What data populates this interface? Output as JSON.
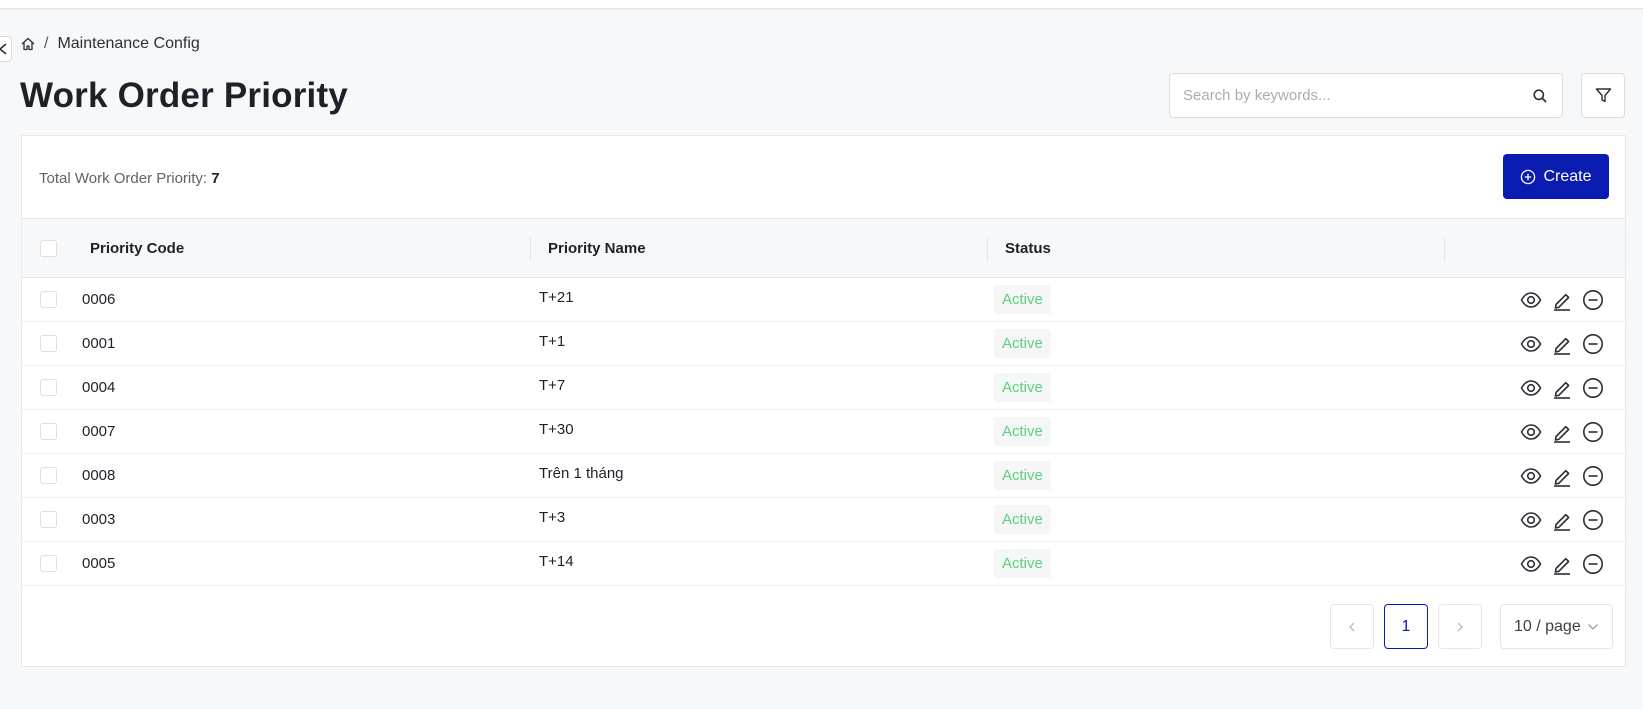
{
  "breadcrumb": {
    "items": [
      "Maintenance Config"
    ]
  },
  "page": {
    "title": "Work Order Priority"
  },
  "search": {
    "placeholder": "Search by keywords..."
  },
  "summary": {
    "label": "Total Work Order Priority:",
    "count": "7"
  },
  "toolbar": {
    "create_label": "Create"
  },
  "table": {
    "columns": [
      "Priority Code",
      "Priority Name",
      "Status"
    ],
    "rows": [
      {
        "code": "0006",
        "name": "T+21",
        "status": "Active"
      },
      {
        "code": "0001",
        "name": "T+1",
        "status": "Active"
      },
      {
        "code": "0004",
        "name": "T+7",
        "status": "Active"
      },
      {
        "code": "0007",
        "name": "T+30",
        "status": "Active"
      },
      {
        "code": "0008",
        "name": "Trên 1 tháng",
        "status": "Active"
      },
      {
        "code": "0003",
        "name": "T+3",
        "status": "Active"
      },
      {
        "code": "0005",
        "name": "T+14",
        "status": "Active"
      }
    ],
    "row_actions": [
      "eye-icon",
      "edit-icon",
      "minus-circle-icon"
    ]
  },
  "pagination": {
    "current_page": "1",
    "page_size": "10 / page"
  },
  "colors": {
    "primary": "#0a1bb0",
    "active_status": "#5fcf80",
    "background": "#f6f8fa"
  }
}
